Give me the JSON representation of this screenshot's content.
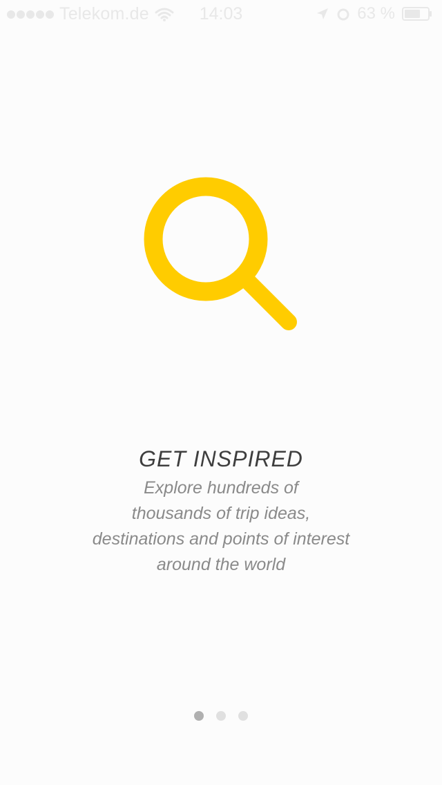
{
  "status_bar": {
    "carrier": "Telekom.de",
    "time": "14:03",
    "battery_percent": "63 %",
    "signal_dots": 5,
    "icon_color": "#e8e8e8"
  },
  "onboarding": {
    "icon": "search-icon",
    "icon_color": "#ffcc00",
    "title": "GET INSPIRED",
    "description_lines": [
      "Explore hundreds of",
      "thousands of trip ideas,",
      "destinations and points of interest",
      "around the world"
    ]
  },
  "pager": {
    "total": 3,
    "current": 1,
    "active_color": "#b0b0b0",
    "inactive_color": "#e0e0e0"
  }
}
